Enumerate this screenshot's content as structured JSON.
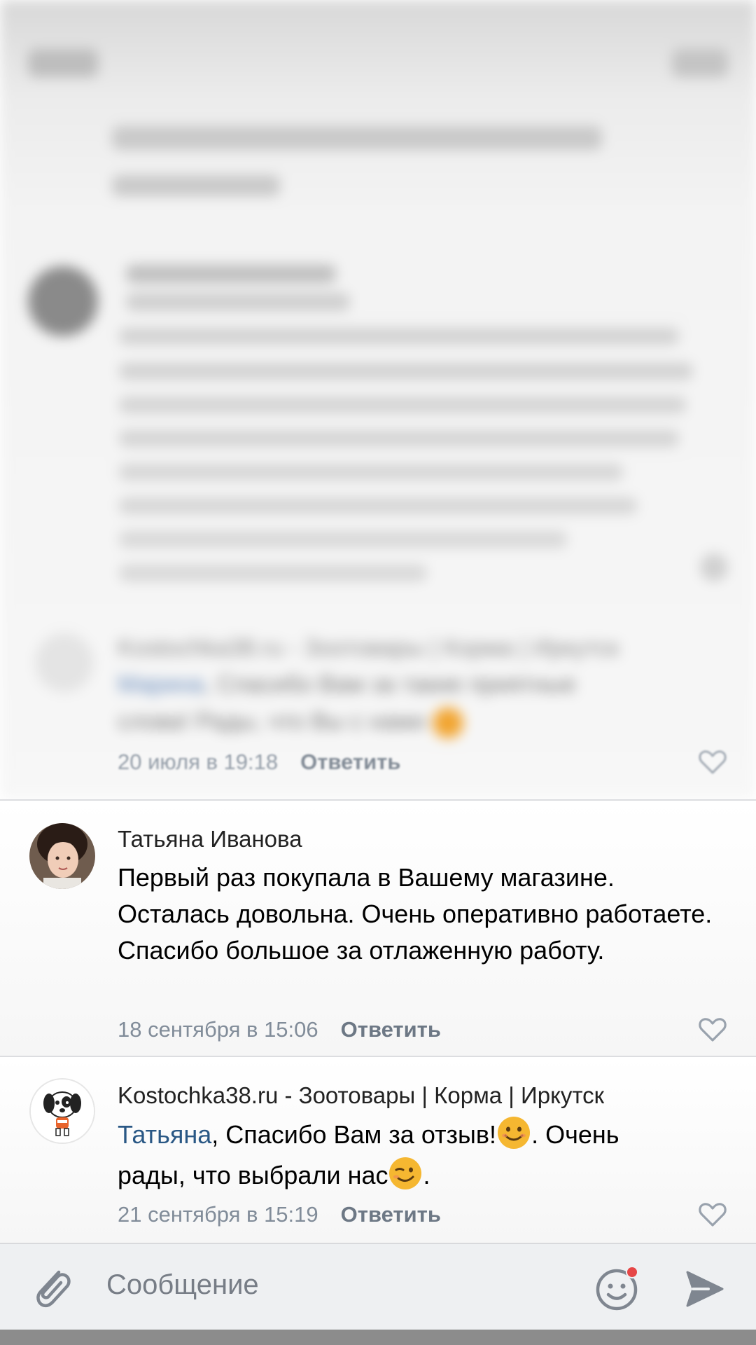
{
  "blurred_reply": {
    "author": "Kostochka38.ru - Зоотовары | Корма | Иркутск",
    "mention": "Марина",
    "text_line1": ", Спасибо Вам за такие приятные",
    "text_line2": "слова! Рады, что Вы с нами",
    "timestamp": "20 июля в 19:18",
    "reply_label": "Ответить"
  },
  "comments": [
    {
      "author": "Татьяна Иванова",
      "text": "Первый раз покупала в Вашему магазине. Осталась довольна. Очень оперативно работаете. Спасибо большое за отлаженную работу.",
      "timestamp": "18 сентября в 15:06",
      "reply_label": "Ответить"
    },
    {
      "author": "Kostochka38.ru - Зоотовары | Корма | Иркутск",
      "mention": "Татьяна",
      "text_part1": ", Спасибо Вам за отзыв!",
      "text_part2": ". Очень",
      "text_part3": "рады, что выбрали нас",
      "text_part4": ".",
      "timestamp": "21 сентября в 15:19",
      "reply_label": "Ответить"
    }
  ],
  "composer": {
    "placeholder": "Сообщение"
  },
  "icons": {
    "attach": "paperclip-icon",
    "emoji": "smile-icon",
    "send": "send-icon",
    "like": "heart-outline-icon"
  },
  "colors": {
    "link": "#2a5885",
    "meta": "#818c99",
    "notification_dot": "#e64646"
  }
}
